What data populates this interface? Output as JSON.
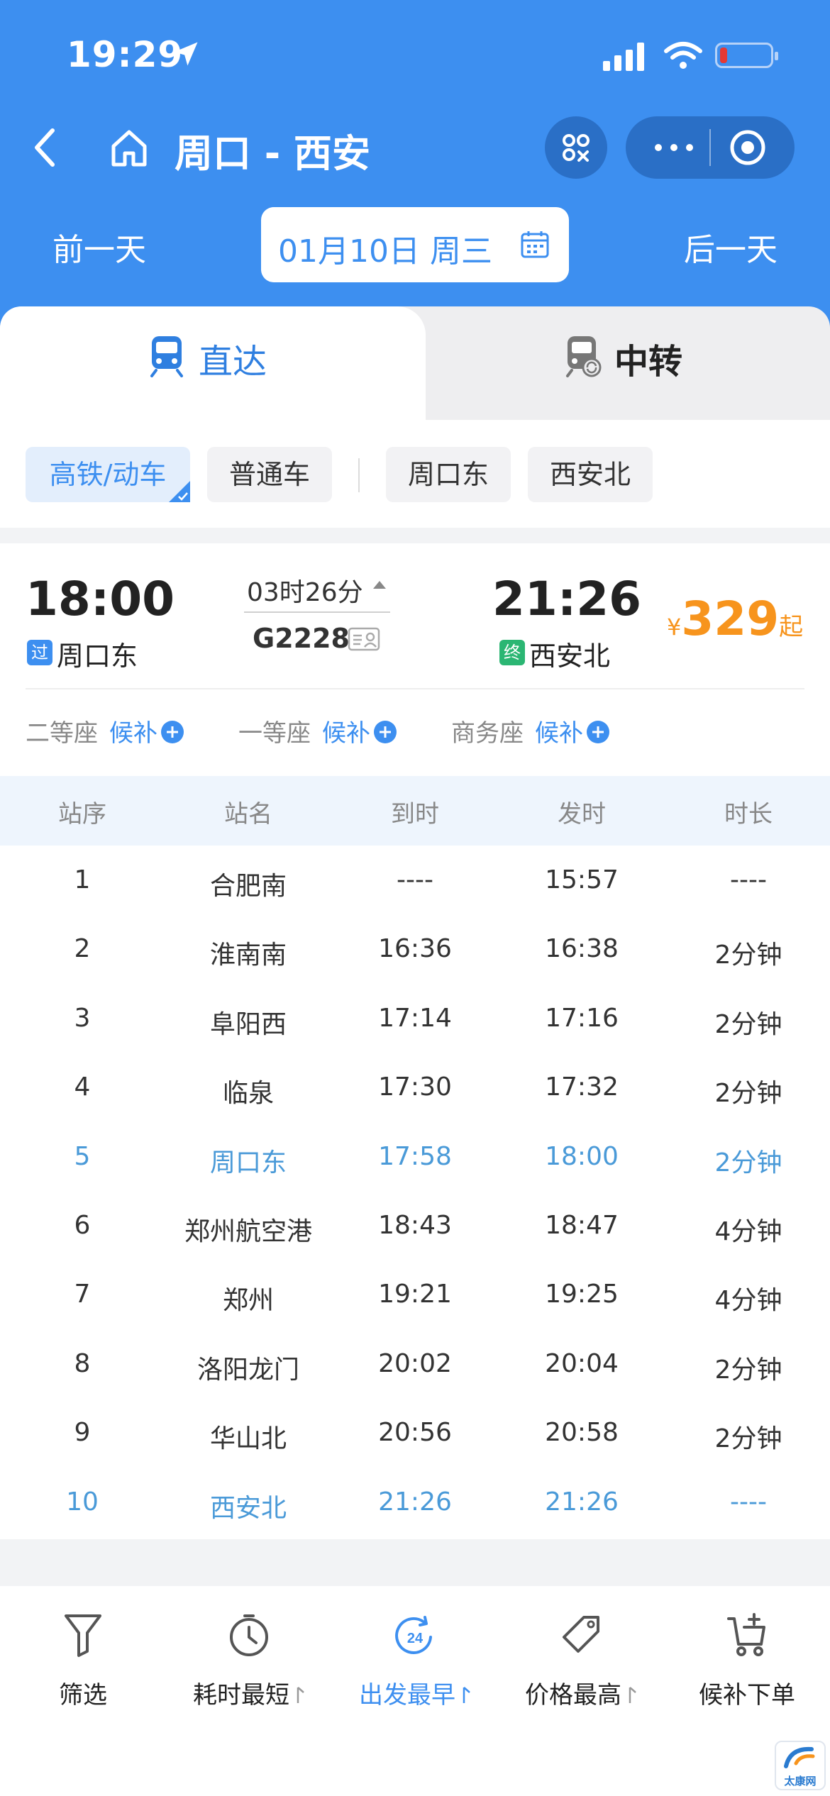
{
  "status": {
    "time": "19:29"
  },
  "nav": {
    "title": "周口 - 西安"
  },
  "datebar": {
    "prev": "前一天",
    "date": "01月10日 周三",
    "next": "后一天"
  },
  "tabs": [
    {
      "label": "直达",
      "active": true
    },
    {
      "label": "中转",
      "active": false
    }
  ],
  "filters": {
    "type_chips": [
      "高铁/动车",
      "普通车"
    ],
    "station_chips": [
      "周口东",
      "西安北"
    ]
  },
  "train": {
    "dep_time": "18:00",
    "dep_badge": "过",
    "dep_station": "周口东",
    "duration": "03时26分",
    "train_no": "G2228",
    "arr_time": "21:26",
    "arr_badge": "终",
    "arr_station": "西安北",
    "price": {
      "currency": "¥",
      "amount": "329",
      "suffix": "起",
      "color": "#f7941d"
    },
    "seats": [
      {
        "name": "二等座",
        "status": "候补"
      },
      {
        "name": "一等座",
        "status": "候补"
      },
      {
        "name": "商务座",
        "status": "候补"
      }
    ]
  },
  "stops_table": {
    "headers": [
      "站序",
      "站名",
      "到时",
      "发时",
      "时长"
    ],
    "rows": [
      {
        "no": "1",
        "name": "合肥南",
        "arr": "----",
        "dep": "15:57",
        "dur": "----",
        "highlight": false
      },
      {
        "no": "2",
        "name": "淮南南",
        "arr": "16:36",
        "dep": "16:38",
        "dur": "2分钟",
        "highlight": false
      },
      {
        "no": "3",
        "name": "阜阳西",
        "arr": "17:14",
        "dep": "17:16",
        "dur": "2分钟",
        "highlight": false
      },
      {
        "no": "4",
        "name": "临泉",
        "arr": "17:30",
        "dep": "17:32",
        "dur": "2分钟",
        "highlight": false
      },
      {
        "no": "5",
        "name": "周口东",
        "arr": "17:58",
        "dep": "18:00",
        "dur": "2分钟",
        "highlight": true
      },
      {
        "no": "6",
        "name": "郑州航空港",
        "arr": "18:43",
        "dep": "18:47",
        "dur": "4分钟",
        "highlight": false
      },
      {
        "no": "7",
        "name": "郑州",
        "arr": "19:21",
        "dep": "19:25",
        "dur": "4分钟",
        "highlight": false
      },
      {
        "no": "8",
        "name": "洛阳龙门",
        "arr": "20:02",
        "dep": "20:04",
        "dur": "2分钟",
        "highlight": false
      },
      {
        "no": "9",
        "name": "华山北",
        "arr": "20:56",
        "dep": "20:58",
        "dur": "2分钟",
        "highlight": false
      },
      {
        "no": "10",
        "name": "西安北",
        "arr": "21:26",
        "dep": "21:26",
        "dur": "----",
        "highlight": true
      }
    ]
  },
  "bottom_bar": [
    {
      "label": "筛选",
      "icon": "filter-icon",
      "active": false,
      "sort_arrow": false
    },
    {
      "label": "耗时最短",
      "icon": "timer-icon",
      "active": false,
      "sort_arrow": true
    },
    {
      "label": "出发最早",
      "icon": "clock-24-icon",
      "active": true,
      "sort_arrow": true
    },
    {
      "label": "价格最高",
      "icon": "price-tag-icon",
      "active": false,
      "sort_arrow": true
    },
    {
      "label": "候补下单",
      "icon": "cart-plus-icon",
      "active": false,
      "sort_arrow": false
    }
  ],
  "watermark": {
    "label": "太康网"
  },
  "colors": {
    "header_blue": "#3d8ff0",
    "accent_blue": "#3d8ff0",
    "highlight_row": "#4a9ad8",
    "price_orange": "#f7941d",
    "end_badge_green": "#2bb673"
  }
}
